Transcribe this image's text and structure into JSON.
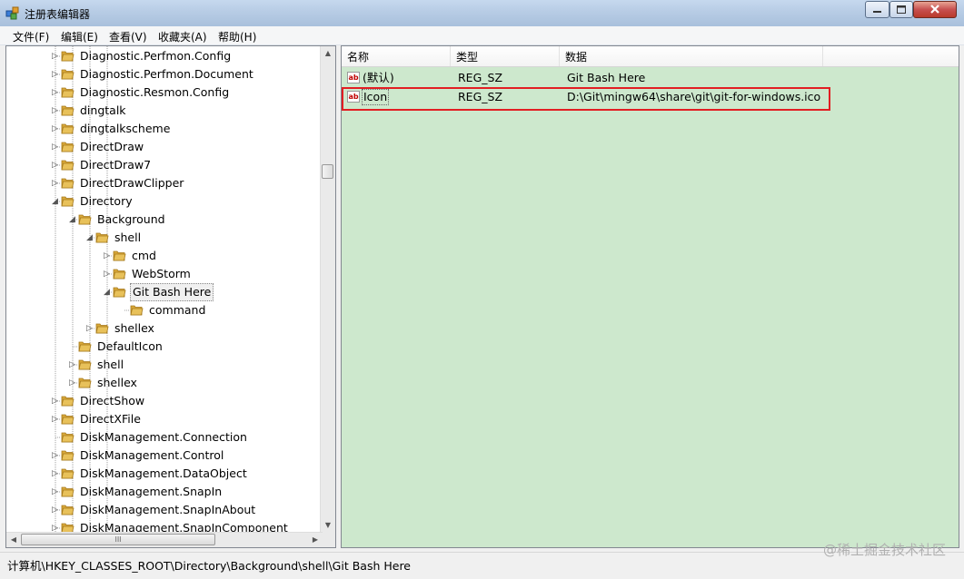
{
  "window": {
    "title": "注册表编辑器"
  },
  "menu": {
    "items": [
      "文件(F)",
      "编辑(E)",
      "查看(V)",
      "收藏夹(A)",
      "帮助(H)"
    ]
  },
  "tree": {
    "items": [
      {
        "label": "Diagnostic.Perfmon.Config",
        "level": 0,
        "exp": "▷"
      },
      {
        "label": "Diagnostic.Perfmon.Document",
        "level": 0,
        "exp": "▷"
      },
      {
        "label": "Diagnostic.Resmon.Config",
        "level": 0,
        "exp": "▷"
      },
      {
        "label": "dingtalk",
        "level": 0,
        "exp": "▷"
      },
      {
        "label": "dingtalkscheme",
        "level": 0,
        "exp": "▷"
      },
      {
        "label": "DirectDraw",
        "level": 0,
        "exp": "▷"
      },
      {
        "label": "DirectDraw7",
        "level": 0,
        "exp": "▷"
      },
      {
        "label": "DirectDrawClipper",
        "level": 0,
        "exp": "▷"
      },
      {
        "label": "Directory",
        "level": 0,
        "exp": "◢"
      },
      {
        "label": "Background",
        "level": 1,
        "exp": "◢"
      },
      {
        "label": "shell",
        "level": 2,
        "exp": "◢"
      },
      {
        "label": "cmd",
        "level": 3,
        "exp": "▷"
      },
      {
        "label": "WebStorm",
        "level": 3,
        "exp": "▷"
      },
      {
        "label": "Git Bash Here",
        "level": 3,
        "exp": "◢",
        "selected": true
      },
      {
        "label": "command",
        "level": 4,
        "exp": ""
      },
      {
        "label": "shellex",
        "level": 2,
        "exp": "▷"
      },
      {
        "label": "DefaultIcon",
        "level": 1,
        "exp": ""
      },
      {
        "label": "shell",
        "level": 1,
        "exp": "▷"
      },
      {
        "label": "shellex",
        "level": 1,
        "exp": "▷"
      },
      {
        "label": "DirectShow",
        "level": 0,
        "exp": "▷"
      },
      {
        "label": "DirectXFile",
        "level": 0,
        "exp": "▷"
      },
      {
        "label": "DiskManagement.Connection",
        "level": 0,
        "exp": ""
      },
      {
        "label": "DiskManagement.Control",
        "level": 0,
        "exp": "▷"
      },
      {
        "label": "DiskManagement.DataObject",
        "level": 0,
        "exp": "▷"
      },
      {
        "label": "DiskManagement.SnapIn",
        "level": 0,
        "exp": "▷"
      },
      {
        "label": "DiskManagement.SnapInAbout",
        "level": 0,
        "exp": "▷"
      },
      {
        "label": "DiskManagement.SnapInComponent",
        "level": 0,
        "exp": "▷"
      }
    ],
    "hscroll_grip": "III"
  },
  "list": {
    "columns": [
      "名称",
      "类型",
      "数据"
    ],
    "rows": [
      {
        "name": "(默认)",
        "type": "REG_SZ",
        "data": "Git Bash Here"
      },
      {
        "name": "Icon",
        "type": "REG_SZ",
        "data": "D:\\Git\\mingw64\\share\\git\\git-for-windows.ico"
      }
    ],
    "icon_text": "ab"
  },
  "status": {
    "path": "计算机\\HKEY_CLASSES_ROOT\\Directory\\Background\\shell\\Git Bash Here"
  },
  "watermark": "@稀土掘金技术社区",
  "colors": {
    "list_bg": "#cde8cd",
    "highlight": "#e21e23",
    "folder": "#e8c15a"
  }
}
